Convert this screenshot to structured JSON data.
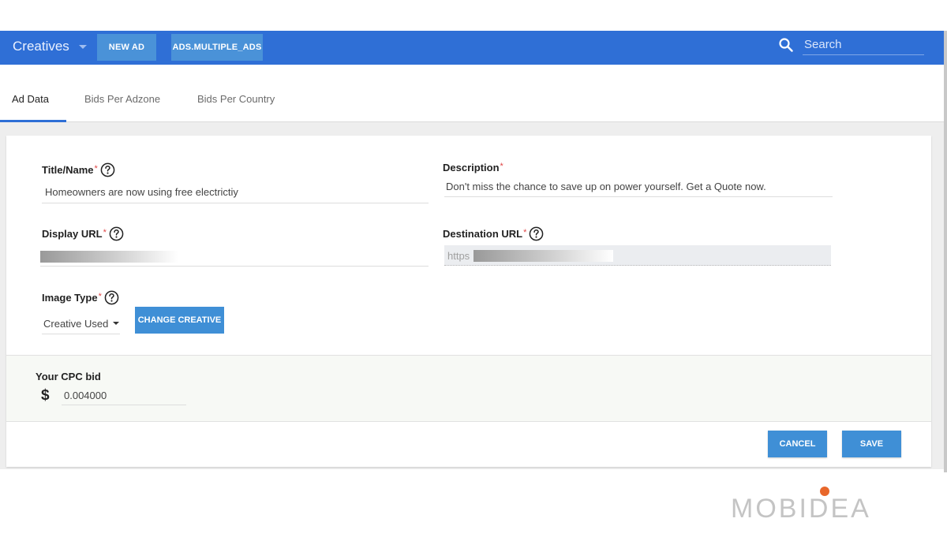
{
  "topbar": {
    "app_title": "Creatives",
    "new_ad_label": "NEW AD",
    "multiple_ads_label": "ADS.MULTIPLE_ADS",
    "search_placeholder": "Search"
  },
  "tabs": [
    {
      "label": "Ad Data",
      "active": true
    },
    {
      "label": "Bids Per Adzone",
      "active": false
    },
    {
      "label": "Bids Per Country",
      "active": false
    }
  ],
  "form": {
    "title_label": "Title/Name",
    "title_value": "Homeowners are now using free electrictiy",
    "description_label": "Description",
    "description_value": "Don't miss the chance to save up on power yourself. Get a Quote now.",
    "display_url_label": "Display URL",
    "destination_url_label": "Destination URL",
    "destination_url_prefix": "https",
    "image_type_label": "Image Type",
    "image_type_value": "Creative Used",
    "change_creative_label": "CHANGE CREATIVE",
    "required_mark": "*"
  },
  "cpc": {
    "label": "Your CPC bid",
    "currency": "$",
    "value": "0.004000"
  },
  "actions": {
    "cancel_label": "CANCEL",
    "save_label": "SAVE"
  },
  "logo": {
    "text": "MOBIDEA"
  },
  "colors": {
    "topbar": "#2f6fd6",
    "button": "#3f8fd6",
    "required": "#e04545",
    "logo_dot": "#e8672b"
  }
}
